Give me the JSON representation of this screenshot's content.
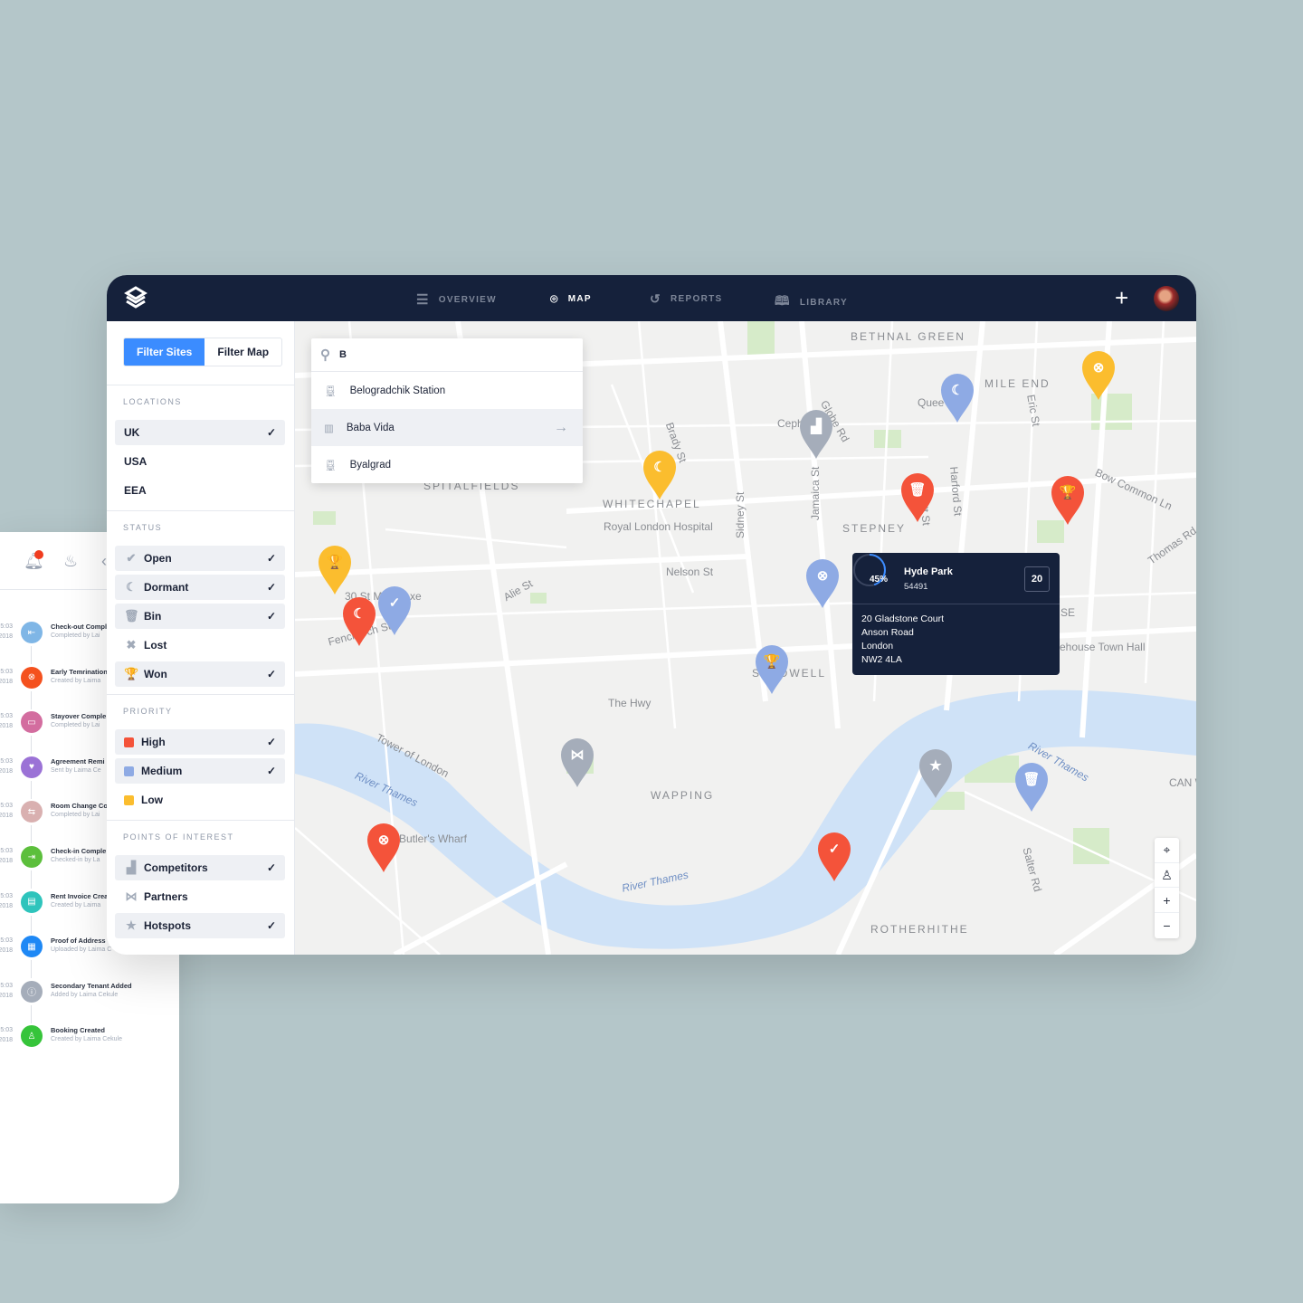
{
  "timeline": {
    "header_icons": [
      "bell-icon",
      "flame-icon",
      "chevron-left-icon"
    ],
    "time": "5:03",
    "date": "2018",
    "items": [
      {
        "title": "Check-out Compl",
        "sub": "Completed by Lai",
        "color": "#7fb6e6",
        "icon": "⇤"
      },
      {
        "title": "Early Temrination",
        "sub": "Created by Laima",
        "color": "#f4511e",
        "icon": "⊗"
      },
      {
        "title": "Stayover Comple",
        "sub": "Completed by Lai",
        "color": "#d36d9f",
        "icon": "▭"
      },
      {
        "title": "Agreement Remi",
        "sub": "Sent by Laima Ce",
        "color": "#9b72d6",
        "icon": "♥"
      },
      {
        "title": "Room Change Co",
        "sub": "Completed by Lai",
        "color": "#d9b0b0",
        "icon": "⇆"
      },
      {
        "title": "Check-in Comple",
        "sub": "Checked-in by La",
        "color": "#5cbf3c",
        "icon": "⇥"
      },
      {
        "title": "Rent Invoice Crea",
        "sub": "Created by Laima",
        "color": "#2ec4bc",
        "icon": "▤"
      },
      {
        "title": "Proof of Address",
        "sub": "Uploaded by Laima C",
        "color": "#1e88f5",
        "icon": "▦"
      },
      {
        "title": "Secondary Tenant Added",
        "sub": "Added by Laima Cekule",
        "color": "#a5adba",
        "icon": "ⓘ"
      },
      {
        "title": "Booking Created",
        "sub": "Created by Laima Cekule",
        "color": "#36c43a",
        "icon": "♙"
      }
    ]
  },
  "nav": {
    "items": [
      {
        "label": "OVERVIEW",
        "icon": "menu-icon"
      },
      {
        "label": "MAP",
        "icon": "map-pin-icon"
      },
      {
        "label": "REPORTS",
        "icon": "history-icon"
      },
      {
        "label": "LIBRARY",
        "icon": "book-icon"
      }
    ],
    "active": "MAP"
  },
  "sidebar": {
    "tabs": [
      "Filter Sites",
      "Filter Map"
    ],
    "locations": {
      "title": "LOCATIONS",
      "items": [
        {
          "label": "UK",
          "checked": true
        },
        {
          "label": "USA",
          "checked": false
        },
        {
          "label": "EEA",
          "checked": false
        }
      ]
    },
    "status": {
      "title": "STATUS",
      "items": [
        {
          "label": "Open",
          "checked": true
        },
        {
          "label": "Dormant",
          "checked": true
        },
        {
          "label": "Bin",
          "checked": true
        },
        {
          "label": "Lost",
          "checked": false
        },
        {
          "label": "Won",
          "checked": true
        }
      ]
    },
    "priority": {
      "title": "PRIORITY",
      "items": [
        {
          "label": "High",
          "color": "#f4533a",
          "checked": true
        },
        {
          "label": "Medium",
          "color": "#8eaae4",
          "checked": true
        },
        {
          "label": "Low",
          "color": "#fbbd2e",
          "checked": false
        }
      ]
    },
    "poi": {
      "title": "POINTS OF INTEREST",
      "items": [
        {
          "label": "Competitors",
          "checked": true
        },
        {
          "label": "Partners",
          "checked": false
        },
        {
          "label": "Hotspots",
          "checked": true
        }
      ]
    },
    "check": "✓"
  },
  "search": {
    "query": "B",
    "results": [
      {
        "label": "Belogradchik Station",
        "icon": "train-icon"
      },
      {
        "label": "Baba Vida",
        "icon": "building-icon",
        "highlighted": true
      },
      {
        "label": "Byalgrad",
        "icon": "train-icon"
      }
    ]
  },
  "tooltip": {
    "percent": 45,
    "percent_label": "45%",
    "name": "Hyde Park",
    "id": "54491",
    "badge": "20",
    "address": [
      "20 Gladstone Court",
      "Anson Road",
      "London",
      "NW2 4LA"
    ]
  },
  "map": {
    "labels": [
      "BETHNAL GREEN",
      "MILE END",
      "WHITECHAPEL",
      "Royal London Hospital",
      "STEPNEY",
      "SPITALFIELDS",
      "Nelson St",
      "Alie St",
      "Fenchurch St",
      "The Hwy",
      "Tower of London",
      "River Thames",
      "WAPPING",
      "Butler's Wharf",
      "River Thames",
      "River Thames",
      "ROTHERHITHE",
      "Salter Rd",
      "Bow Common Ln",
      "Thomas Rd",
      "Globe Rd",
      "Brady St",
      "Sidney St",
      "Jamaica St",
      "Duckett St",
      "Harford St",
      "Eric St",
      "ehouse Town Hall",
      "Ceph",
      "Quee",
      "CAN WH",
      "SE",
      "SHADWELL",
      "30 St M",
      "xe"
    ],
    "pins": [
      {
        "color": "#fbbd2e",
        "icon": "⊗"
      },
      {
        "color": "#8eaae4",
        "icon": "☾"
      },
      {
        "color": "#a5adba",
        "icon": "▟"
      },
      {
        "color": "#fbbd2e",
        "icon": "☾"
      },
      {
        "color": "#f4533a",
        "icon": "🗑"
      },
      {
        "color": "#f4533a",
        "icon": "🏆"
      },
      {
        "color": "#fbbd2e",
        "icon": "🏆"
      },
      {
        "color": "#f4533a",
        "icon": "☾"
      },
      {
        "color": "#8eaae4",
        "icon": "✓"
      },
      {
        "color": "#8eaae4",
        "icon": "⊗"
      },
      {
        "color": "#8eaae4",
        "icon": "🏆"
      },
      {
        "color": "#a5adba",
        "icon": "⋈"
      },
      {
        "color": "#a5adba",
        "icon": "★"
      },
      {
        "color": "#8eaae4",
        "icon": "🗑"
      },
      {
        "color": "#f4533a",
        "icon": "⊗"
      },
      {
        "color": "#f4533a",
        "icon": "✓"
      }
    ],
    "controls": [
      "⌖",
      "♙",
      "+",
      "−"
    ]
  },
  "colors": {
    "nav": "#15213b",
    "accent": "#3b8cff",
    "water": "#cfe2f7",
    "park": "#cfe5c3"
  }
}
